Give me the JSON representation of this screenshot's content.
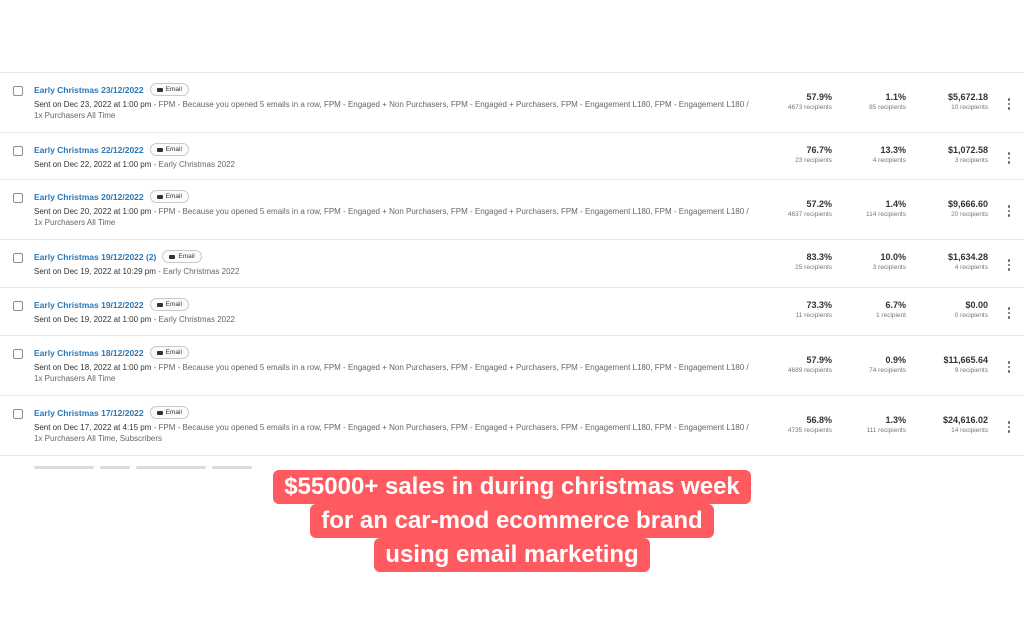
{
  "campaigns": [
    {
      "title": "Early Christmas 23/12/2022",
      "badge": "Email",
      "sent": "Sent on Dec 23, 2022 at 1:00 pm",
      "desc": " - FPM - Because you opened 5 emails in a row, FPM - Engaged + Non Purchasers, FPM - Engaged + Purchasers, FPM - Engagement L180, FPM - Engagement L180 / 1x Purchasers All Time",
      "open_rate": "57.9%",
      "open_recipients": "4673 recipients",
      "click_rate": "1.1%",
      "click_recipients": "85 recipients",
      "revenue": "$5,672.18",
      "revenue_recipients": "10 recipients"
    },
    {
      "title": "Early Christmas 22/12/2022",
      "badge": "Email",
      "sent": "Sent on Dec 22, 2022 at 1:00 pm",
      "desc": " - Early Christmas 2022",
      "open_rate": "76.7%",
      "open_recipients": "23 recipients",
      "click_rate": "13.3%",
      "click_recipients": "4 recipients",
      "revenue": "$1,072.58",
      "revenue_recipients": "3 recipients"
    },
    {
      "title": "Early Christmas 20/12/2022",
      "badge": "Email",
      "sent": "Sent on Dec 20, 2022 at 1:00 pm",
      "desc": " - FPM - Because you opened 5 emails in a row, FPM - Engaged + Non Purchasers, FPM - Engaged + Purchasers, FPM - Engagement L180, FPM - Engagement L180 / 1x Purchasers All Time",
      "open_rate": "57.2%",
      "open_recipients": "4637 recipients",
      "click_rate": "1.4%",
      "click_recipients": "114 recipients",
      "revenue": "$9,666.60",
      "revenue_recipients": "20 recipients"
    },
    {
      "title": "Early Christmas 19/12/2022 (2)",
      "badge": "Email",
      "sent": "Sent on Dec 19, 2022 at 10:29 pm",
      "desc": " - Early Christmas 2022",
      "open_rate": "83.3%",
      "open_recipients": "25 recipients",
      "click_rate": "10.0%",
      "click_recipients": "3 recipients",
      "revenue": "$1,634.28",
      "revenue_recipients": "4 recipients"
    },
    {
      "title": "Early Christmas 19/12/2022",
      "badge": "Email",
      "sent": "Sent on Dec 19, 2022 at 1:00 pm",
      "desc": " - Early Christmas 2022",
      "open_rate": "73.3%",
      "open_recipients": "11 recipients",
      "click_rate": "6.7%",
      "click_recipients": "1 recipient",
      "revenue": "$0.00",
      "revenue_recipients": "0 recipients"
    },
    {
      "title": "Early Christmas 18/12/2022",
      "badge": "Email",
      "sent": "Sent on Dec 18, 2022 at 1:00 pm",
      "desc": " - FPM - Because you opened 5 emails in a row, FPM - Engaged + Non Purchasers, FPM - Engaged + Purchasers, FPM - Engagement L180, FPM - Engagement L180 / 1x Purchasers All Time",
      "open_rate": "57.9%",
      "open_recipients": "4689 recipients",
      "click_rate": "0.9%",
      "click_recipients": "74 recipients",
      "revenue": "$11,665.64",
      "revenue_recipients": "9 recipients"
    },
    {
      "title": "Early Christmas 17/12/2022",
      "badge": "Email",
      "sent": "Sent on Dec 17, 2022 at 4:15 pm",
      "desc": " - FPM - Because you opened 5 emails in a row, FPM - Engaged + Non Purchasers, FPM - Engaged + Purchasers, FPM - Engagement L180, FPM - Engagement L180 / 1x Purchasers All Time, Subscribers",
      "open_rate": "56.8%",
      "open_recipients": "4735 recipients",
      "click_rate": "1.3%",
      "click_recipients": "111 recipients",
      "revenue": "$24,616.02",
      "revenue_recipients": "14 recipients"
    }
  ],
  "icons": {
    "badge_icon": "envelope-icon",
    "row_menu": "kebab-menu-icon",
    "checkbox": "checkbox"
  },
  "caption": {
    "lines": [
      "$55000+ sales in during christmas week",
      "for an car-mod ecommerce brand",
      "using email marketing"
    ]
  },
  "colors": {
    "accent": "#ff5a5f",
    "link": "#2a78b8"
  }
}
